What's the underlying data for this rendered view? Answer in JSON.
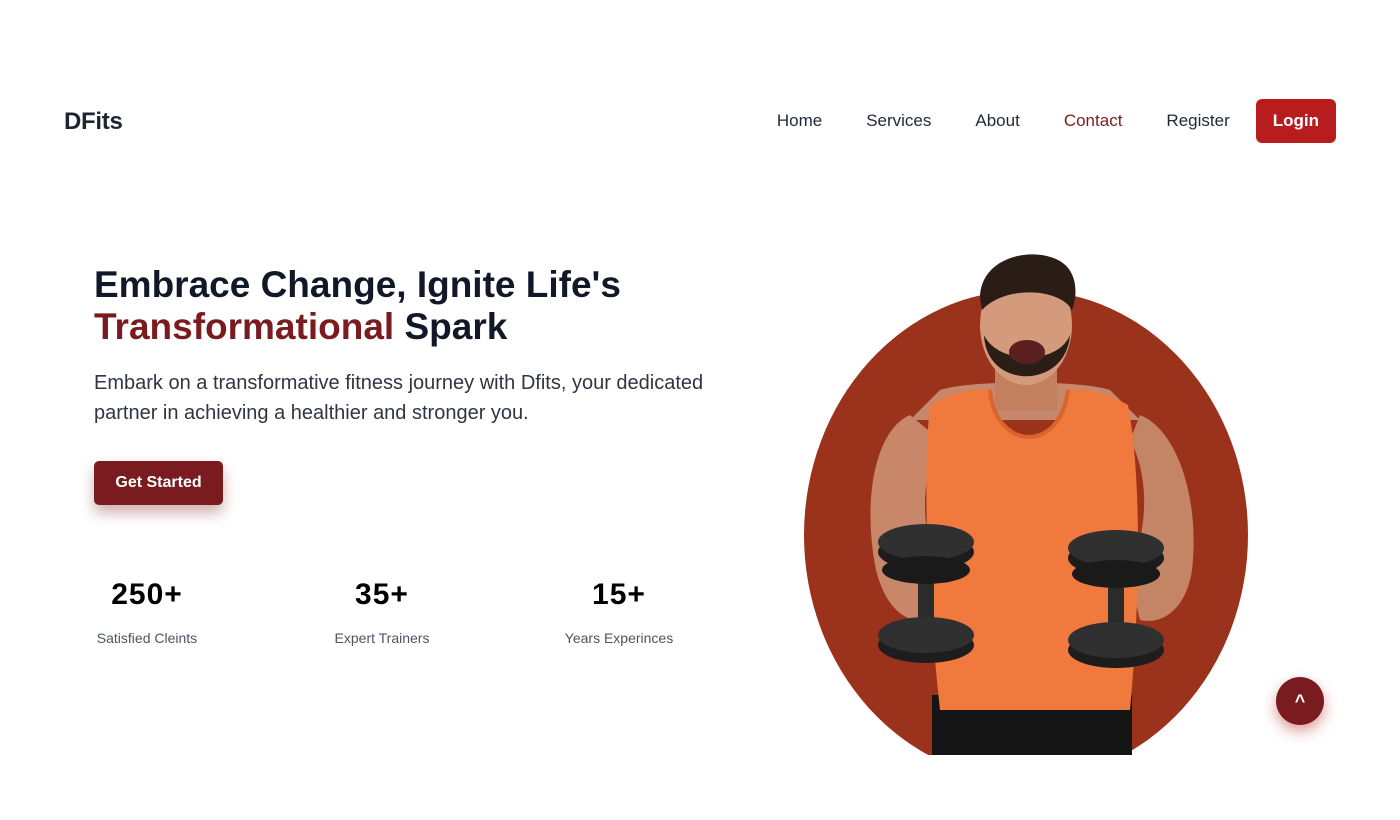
{
  "brand": {
    "name": "DFits"
  },
  "nav": {
    "items": [
      "Home",
      "Services",
      "About",
      "Contact",
      "Register"
    ],
    "active": "Contact",
    "login_label": "Login"
  },
  "hero": {
    "title_line1": "Embrace Change, Ignite Life's",
    "title_accent": "Transformational",
    "title_rest": " Spark",
    "subtitle": "Embark on a transformative fitness journey with Dfits, your dedicated partner in achieving a healthier and stronger you.",
    "cta_label": "Get Started"
  },
  "stats": [
    {
      "value": "250+",
      "label": "Satisfied Cleints"
    },
    {
      "value": "35+",
      "label": "Expert Trainers"
    },
    {
      "value": "15+",
      "label": "Years Experinces"
    }
  ],
  "scroll_top": {
    "label": "^"
  },
  "colors": {
    "accent": "#7a1c1f",
    "login": "#b91c1c",
    "circle": "#9b321c",
    "tank": "#f0793d"
  }
}
